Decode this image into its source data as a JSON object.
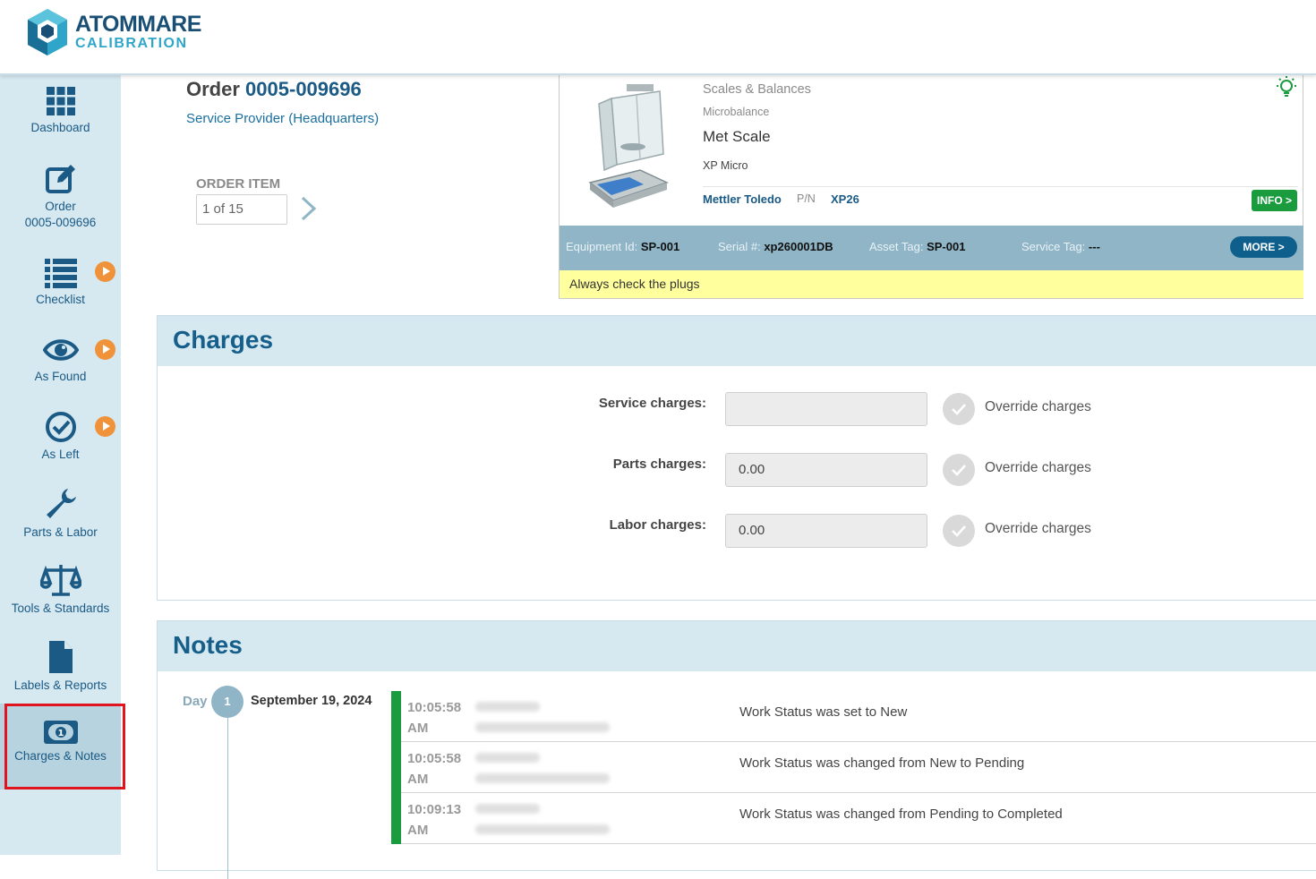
{
  "brand": {
    "line1": "ATOMMARE",
    "line2": "CALIBRATION",
    "primary": "#1a4f75",
    "accent": "#2fa6c9"
  },
  "sidebar": {
    "items": [
      {
        "label": "Dashboard",
        "icon": "grid-icon"
      },
      {
        "label": "Order",
        "sublabel": "0005-009696",
        "icon": "edit-icon"
      },
      {
        "label": "Checklist",
        "icon": "list-icon",
        "badge": "play-icon"
      },
      {
        "label": "As Found",
        "icon": "eye-icon",
        "badge": "play-icon"
      },
      {
        "label": "As Left",
        "icon": "check-circle-icon",
        "badge": "play-icon"
      },
      {
        "label": "Parts & Labor",
        "icon": "wrench-icon"
      },
      {
        "label": "Tools & Standards",
        "icon": "scale-icon"
      },
      {
        "label": "Labels & Reports",
        "icon": "document-icon"
      },
      {
        "label": "Charges & Notes",
        "icon": "money-icon",
        "active": true
      }
    ]
  },
  "order": {
    "prefix": "Order",
    "number": "0005-009696",
    "provider": "Service Provider (Headquarters)",
    "item_label": "ORDER ITEM",
    "item_value": "1 of 15"
  },
  "equipment": {
    "category": "Scales & Balances",
    "subcategory": "Microbalance",
    "name": "Met Scale",
    "model": "XP Micro",
    "manufacturer": "Mettler Toledo",
    "pn_label": "P/N",
    "pn_value": "XP26",
    "info_label": "INFO >",
    "equipment_id_label": "Equipment Id:",
    "equipment_id": "SP-001",
    "serial_label": "Serial #:",
    "serial": "xp260001DB",
    "asset_tag_label": "Asset Tag:",
    "asset_tag": "SP-001",
    "service_tag_label": "Service Tag:",
    "service_tag": "---",
    "more_label": "MORE >",
    "note": "Always check the plugs"
  },
  "charges": {
    "title": "Charges",
    "override_label": "Override charges",
    "rows": [
      {
        "label": "Service charges:",
        "value": ""
      },
      {
        "label": "Parts charges:",
        "value": "0.00"
      },
      {
        "label": "Labor charges:",
        "value": "0.00"
      }
    ]
  },
  "notes": {
    "title": "Notes",
    "day_label": "Day",
    "day_number": "1",
    "date": "September 19, 2024",
    "entries": [
      {
        "time": "10:05:58",
        "ampm": "AM",
        "message": "Work Status was set to New"
      },
      {
        "time": "10:05:58",
        "ampm": "AM",
        "message": "Work Status was changed from New to Pending"
      },
      {
        "time": "10:09:13",
        "ampm": "AM",
        "message": "Work Status was changed from Pending to Completed"
      }
    ]
  }
}
